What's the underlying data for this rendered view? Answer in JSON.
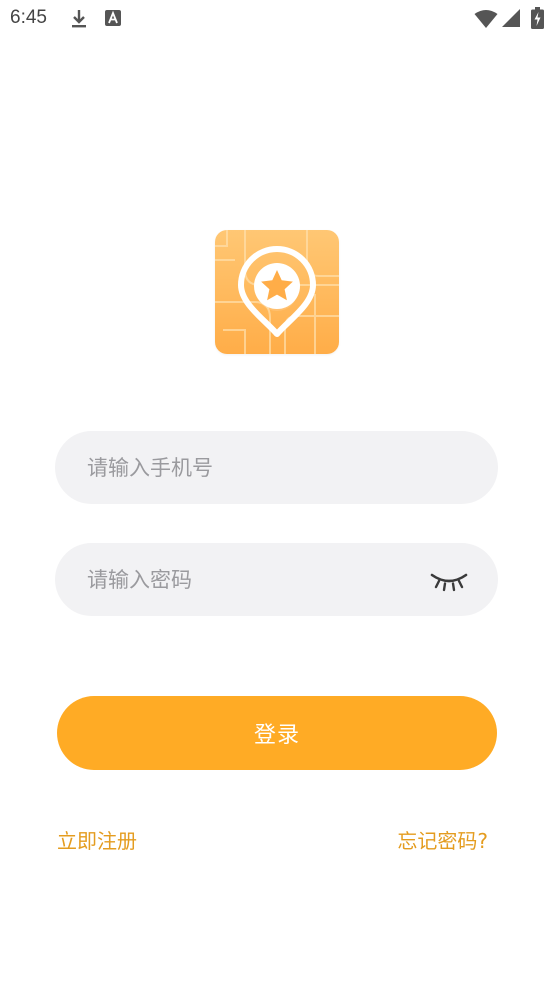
{
  "status_bar": {
    "time": "6:45",
    "icons": [
      "download-icon",
      "text-a-icon",
      "wifi-icon",
      "signal-icon",
      "battery-charging-icon"
    ]
  },
  "logo": {
    "icon": "map-pin-star-icon",
    "colors": {
      "bg_top": "#ffc774",
      "bg_bottom": "#ffad48",
      "pin": "#ffffff"
    }
  },
  "form": {
    "phone": {
      "placeholder": "请输入手机号",
      "value": ""
    },
    "password": {
      "placeholder": "请输入密码",
      "value": "",
      "toggle_icon": "eye-closed-icon"
    },
    "login_label": "登录"
  },
  "links": {
    "register": "立即注册",
    "forgot": "忘记密码?"
  },
  "colors": {
    "accent": "#ffab25",
    "link": "#e49c1f",
    "field_bg": "#f2f2f4",
    "placeholder": "#9a9a9e"
  }
}
